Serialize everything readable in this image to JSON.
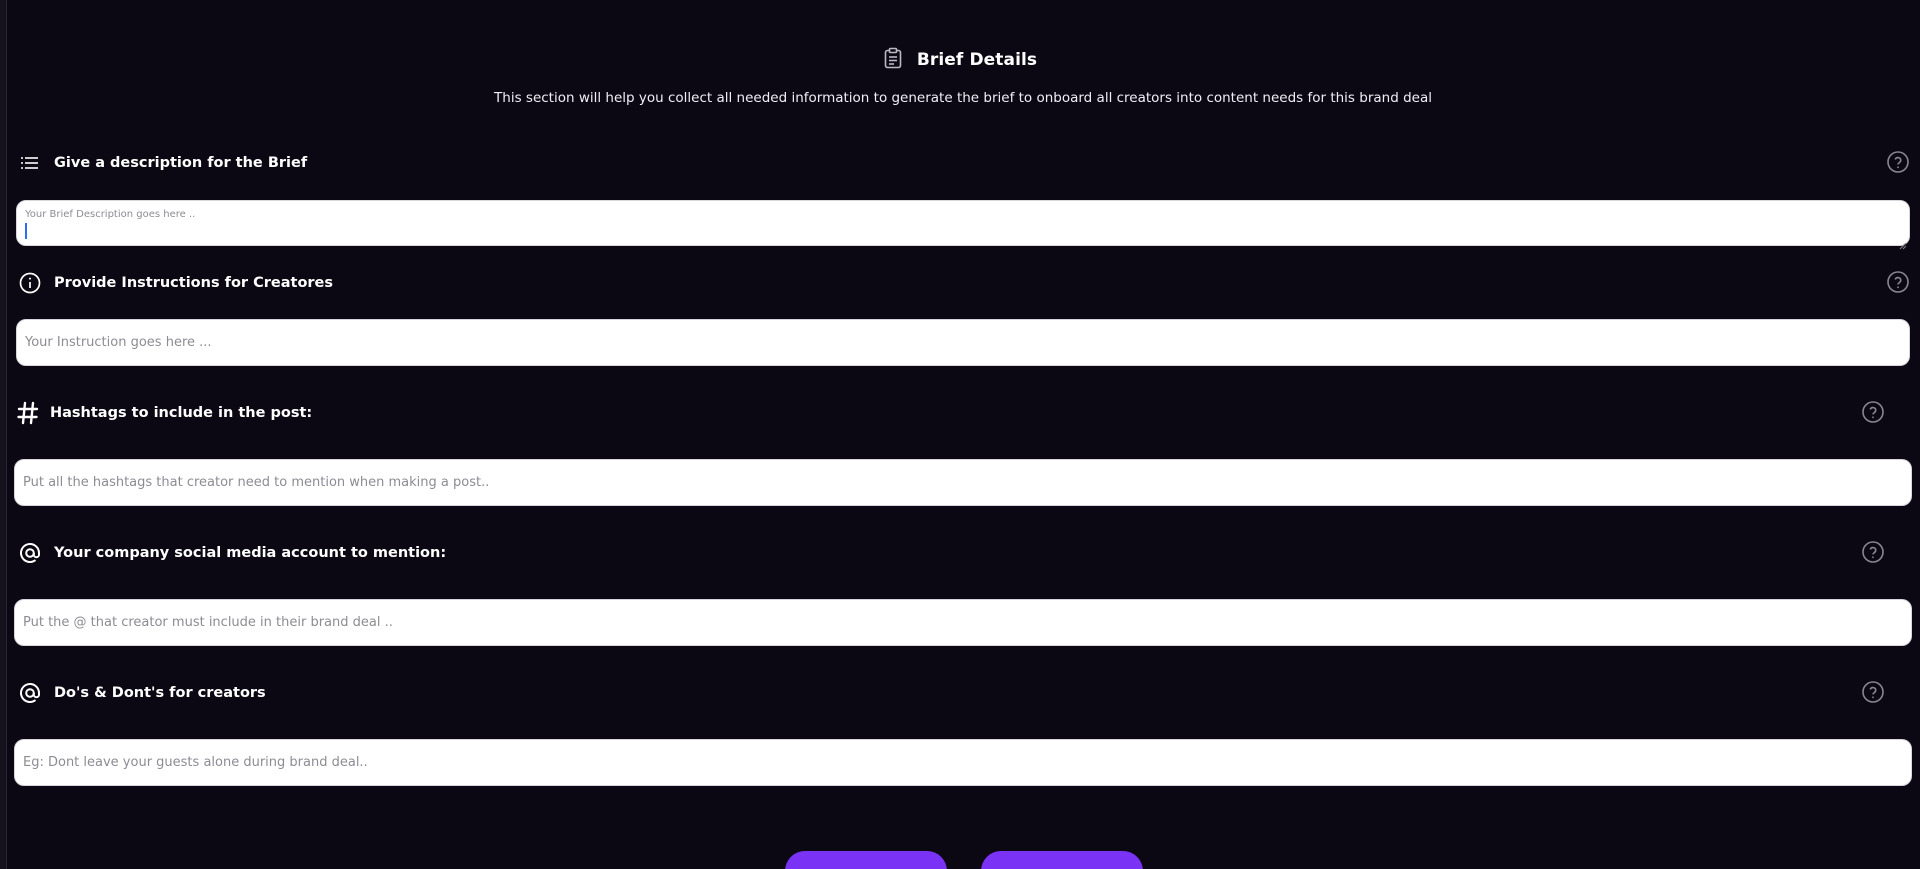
{
  "header": {
    "title": "Brief Details",
    "subtitle": "This section will help you collect all needed information to generate the brief to onboard all creators into content needs for this brand deal"
  },
  "sections": [
    {
      "title": "Give a description for the Brief",
      "icon": "list-icon",
      "placeholder": "Your Brief Description goes here .."
    },
    {
      "title": "Provide Instructions for Creatores",
      "icon": "info-icon",
      "placeholder": "Your Instruction goes here ..."
    },
    {
      "title": "Hashtags to include in the post:",
      "icon": "hashtag-icon",
      "placeholder": "Put all the hashtags that creator need to mention when making a post.."
    },
    {
      "title": "Your company social media account to mention:",
      "icon": "at-sign-icon",
      "placeholder": "Put the @ that creator must include in their brand deal .."
    },
    {
      "title": "Do's & Dont's for creators",
      "icon": "at-sign-icon",
      "placeholder": "Eg: Dont leave your guests alone during brand deal.."
    }
  ],
  "colors": {
    "background": "#0b0713",
    "accent": "#7a32f5",
    "caret": "#2b6cf0"
  }
}
